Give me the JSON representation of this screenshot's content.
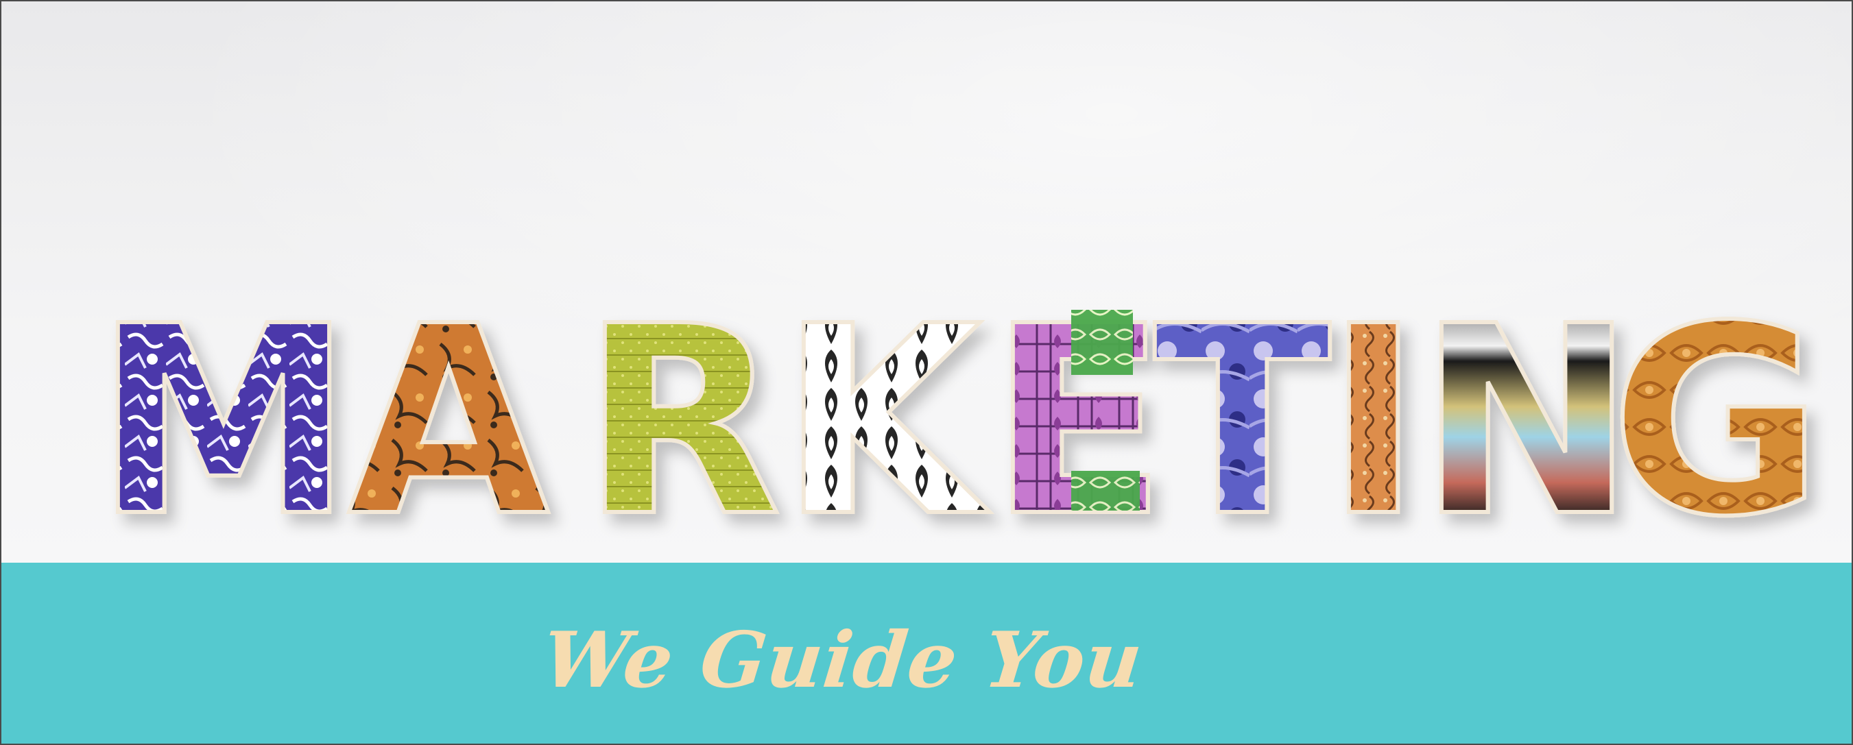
{
  "photo": {
    "word": "MARKETING",
    "letters": [
      "M",
      "A",
      "R",
      "K",
      "E",
      "T",
      "I",
      "N",
      "G"
    ],
    "colors": {
      "wall": "#efeff0",
      "m": "#4a3aa8",
      "a": "#c8742f",
      "r": "#b6bf3a",
      "k": "#2a2a2a",
      "e_pink": "#c77ad0",
      "e_green": "#49a84a",
      "t": "#5c5cc4",
      "i": "#d98a4a",
      "n": "#1e1e1e",
      "g": "#d38a35"
    }
  },
  "band": {
    "tagline": "We Guide You",
    "colors": {
      "background": "#55c9cf",
      "text": "#f6dcb0"
    }
  }
}
